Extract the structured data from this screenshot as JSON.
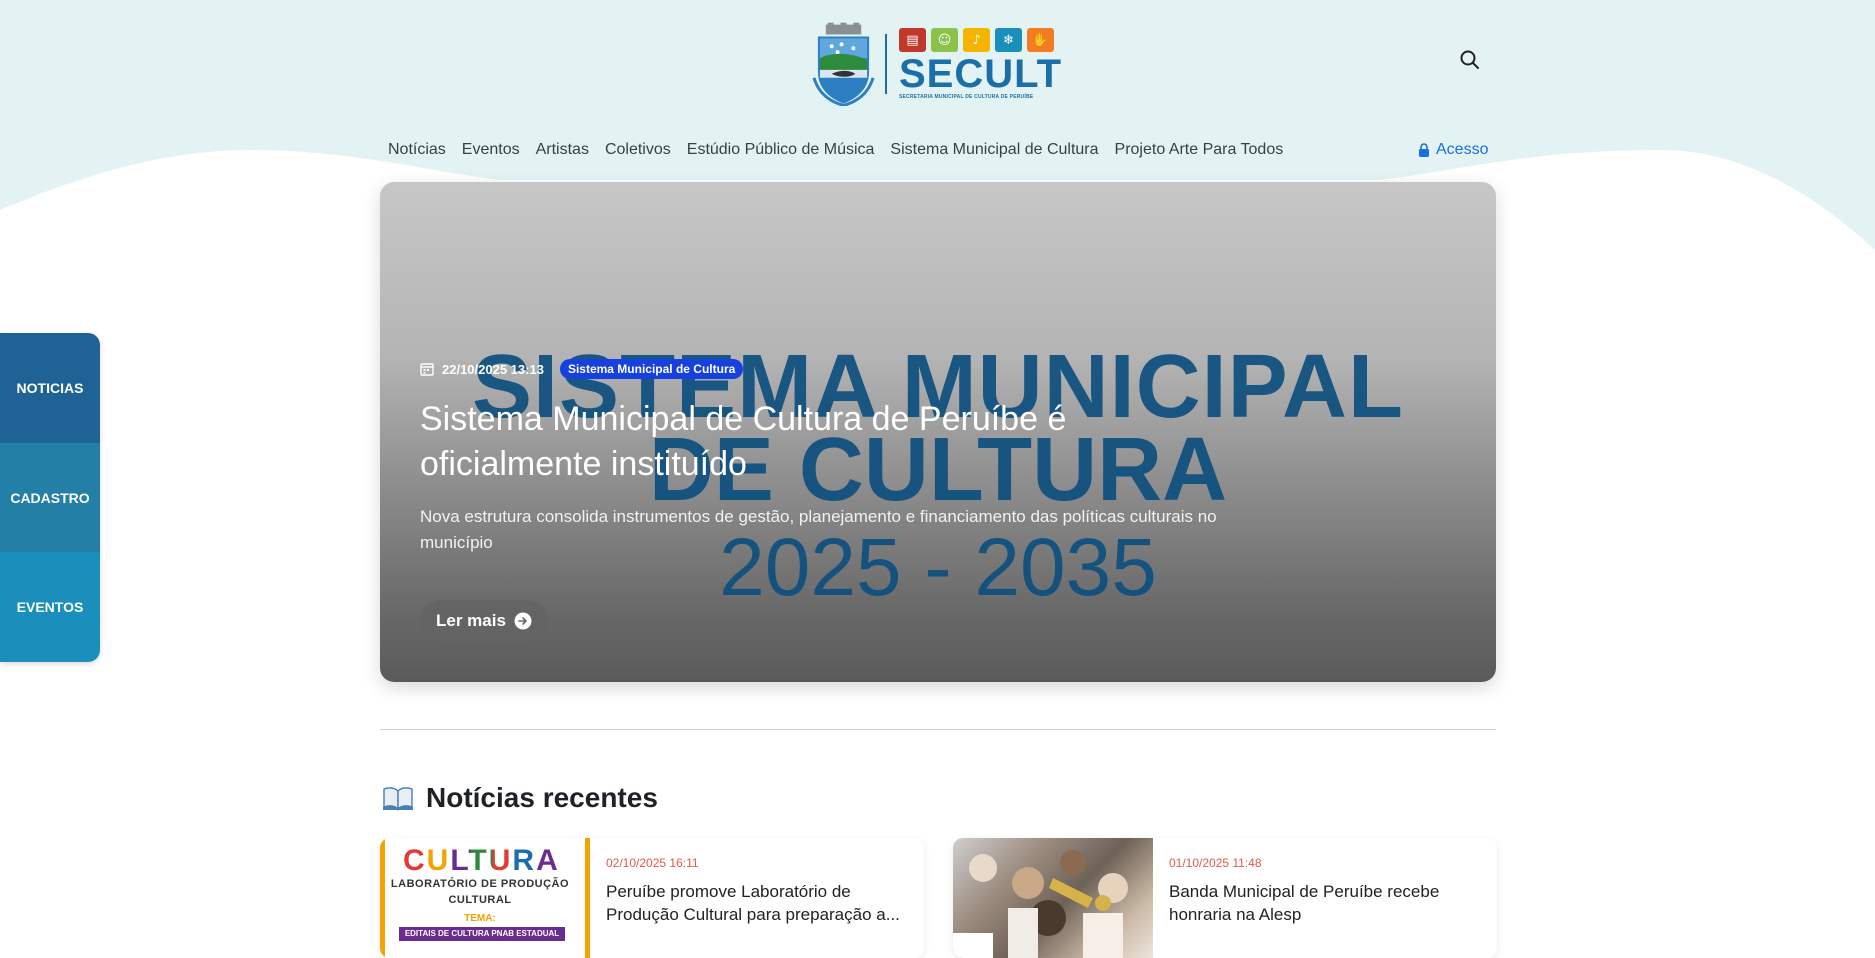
{
  "brand": {
    "name": "SECULT",
    "subtitle": "SECRETARIA MUNICIPAL DE CULTURA DE PERUÍBE",
    "colors": {
      "primary": "#1b6fa8",
      "accent_link": "#1a6fe0",
      "badge": "#1640e0",
      "date": "#e0594e"
    },
    "icon_tiles": [
      {
        "icon": "book-icon",
        "color": "#c0392b",
        "glyph": "▤"
      },
      {
        "icon": "masks-icon",
        "color": "#8bc34a",
        "glyph": "☺"
      },
      {
        "icon": "music-icon",
        "color": "#f4b400",
        "glyph": "♪"
      },
      {
        "icon": "snowflake-icon",
        "color": "#1a8fbb",
        "glyph": "❄"
      },
      {
        "icon": "hand-icon",
        "color": "#f47c20",
        "glyph": "✋"
      }
    ]
  },
  "nav": {
    "items": [
      "Notícias",
      "Eventos",
      "Artistas",
      "Coletivos",
      "Estúdio Público de Música",
      "Sistema Municipal de Cultura",
      "Projeto Arte Para Todos"
    ],
    "login_label": "Acesso"
  },
  "side_tabs": [
    "NOTICIAS",
    "CADASTRO",
    "EVENTOS"
  ],
  "hero": {
    "background_text": [
      "SISTEMA MUNICIPAL",
      "DE CULTURA",
      "2025 - 2035"
    ],
    "date": "22/10/2025 13:13",
    "category": "Sistema Municipal de Cultura",
    "title": "Sistema Municipal de Cultura de Peruíbe é oficialmente instituído",
    "description": "Nova estrutura consolida instrumentos de gestão, planejamento e financiamento das políticas culturais no município",
    "button_label": "Ler mais"
  },
  "recent": {
    "title": "Notícias recentes",
    "cards": [
      {
        "date": "02/10/2025 16:11",
        "title": "Peruíbe promove Laboratório de Produção Cultural para preparação a...",
        "thumb": {
          "word": "CULTURA",
          "line1": "LABORATÓRIO DE PRODUÇÃO",
          "line2": "CULTURAL",
          "tema": "TEMA:",
          "band": "EDITAIS DE CULTURA PNAB ESTADUAL"
        }
      },
      {
        "date": "01/10/2025 11:48",
        "title": "Banda Municipal de Peruíbe recebe honraria na Alesp"
      }
    ]
  }
}
